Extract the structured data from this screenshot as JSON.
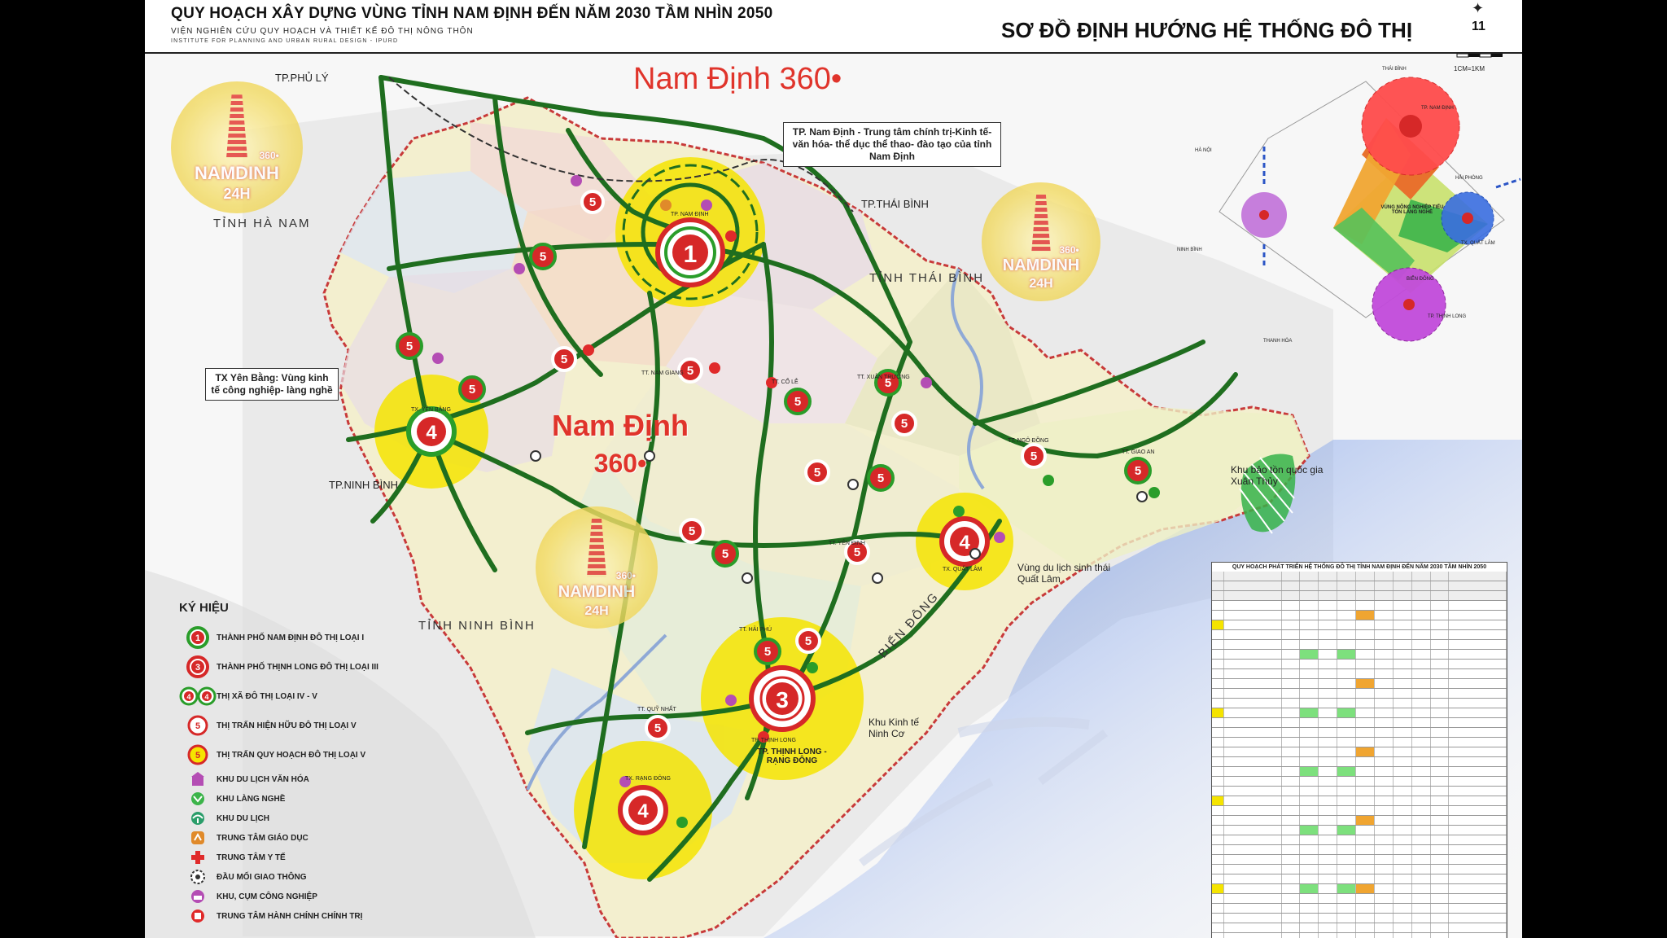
{
  "header": {
    "title": "QUY HOẠCH XÂY DỰNG VÙNG TỈNH NAM ĐỊNH ĐẾN NĂM 2030 TẦM NHÌN 2050",
    "subtitle_vn": "VIỆN NGHIÊN CỨU QUY HOẠCH VÀ THIẾT KẾ ĐÔ THỊ NÔNG THÔN",
    "subtitle_en": "INSTITUTE FOR PLANNING AND URBAN RURAL DESIGN - IPURD",
    "map_title": "SƠ ĐỒ ĐỊNH HƯỚNG HỆ THỐNG ĐÔ THỊ",
    "page_number": "11",
    "scale_label": "1CM=1KM"
  },
  "branding": {
    "watermark_top": "Nam Định 360•",
    "watermark_center_1": "Nam Định",
    "watermark_center_2": "360•",
    "logo_text": "NAMDINH",
    "logo_sub": "24H",
    "logo_badge": "360•"
  },
  "regions": {
    "ha_nam": "TỈNH HÀ NAM",
    "thai_binh": "TỈNH THÁI BÌNH",
    "ninh_binh": "TỈNH NINH BÌNH",
    "bien_dong": "BIỂN ĐÔNG"
  },
  "cities": {
    "phu_ly": "TP.PHỦ LÝ",
    "thai_binh": "TP.THÁI BÌNH",
    "ninh_binh": "TP.NINH BÌNH"
  },
  "callouts": {
    "nam_dinh": "TP. Nam Định - Trung tâm chính trị-Kinh tế-văn hóa- thể dục thể thao- đào tạo của tỉnh Nam Định",
    "yen_bang": "TX Yên Bằng: Vùng kinh tế công nghiệp- làng nghề",
    "xuan_thuy": "Khu bảo tồn quốc gia Xuân Thủy",
    "quat_lam": "Vùng du lịch sinh thái Quất Lâm",
    "ninh_co": "Khu Kinh tế Ninh Cơ",
    "thinh_long": "TP. THỊNH LONG - RẠNG ĐÔNG"
  },
  "towns": [
    {
      "id": "1",
      "name": "TP. NAM ĐỊNH"
    },
    {
      "id": "3",
      "name": "TP. THỊNH LONG"
    },
    {
      "id": "4a",
      "name": "TX. YÊN BẰNG"
    },
    {
      "id": "4b",
      "name": "TX. QUẤT LÂM"
    },
    {
      "id": "4c",
      "name": "TX. RẠNG ĐÔNG"
    },
    {
      "id": "5",
      "name": "TT. NAM GIANG"
    },
    {
      "id": "5",
      "name": "TT. CỔ LỄ"
    },
    {
      "id": "5",
      "name": "TT. XUÂN TRƯỜNG"
    },
    {
      "id": "5",
      "name": "TT. NGÔ ĐỒNG"
    },
    {
      "id": "5",
      "name": "TT. GIAO AN"
    },
    {
      "id": "5",
      "name": "TT. YÊN ĐỊNH"
    },
    {
      "id": "5",
      "name": "TT. HẢI PHÚ"
    },
    {
      "id": "5",
      "name": "TT. QUỸ NHẤT"
    }
  ],
  "legend": {
    "title": "KÝ HIỆU",
    "items": [
      {
        "sym": "1",
        "text": "THÀNH PHỐ NAM ĐỊNH ĐÔ THỊ LOẠI I"
      },
      {
        "sym": "3",
        "text": "THÀNH PHỐ THỊNH LONG ĐÔ THỊ LOẠI III"
      },
      {
        "sym": "4",
        "text": "THỊ XÃ ĐÔ THỊ LOẠI IV - V"
      },
      {
        "sym": "5",
        "text": "THỊ TRẤN HIỆN HỮU ĐÔ THỊ LOẠI V"
      },
      {
        "sym": "5",
        "text": "THỊ TRẤN QUY HOẠCH ĐÔ THỊ LOẠI V"
      },
      {
        "sym": "travel",
        "text": "KHU DU LỊCH VĂN HÓA"
      },
      {
        "sym": "village",
        "text": "KHU LÀNG NGHỀ"
      },
      {
        "sym": "tourism",
        "text": "KHU DU LỊCH"
      },
      {
        "sym": "edu",
        "text": "TRUNG TÂM GIÁO DỤC"
      },
      {
        "sym": "med",
        "text": "TRUNG TÂM Y TẾ"
      },
      {
        "sym": "transport",
        "text": "ĐẦU MỐI GIAO THÔNG"
      },
      {
        "sym": "industry",
        "text": "KHU, CỤM CÔNG NGHIỆP"
      },
      {
        "sym": "admin",
        "text": "TRUNG TÂM HÀNH CHÍNH CHÍNH TRỊ"
      }
    ]
  },
  "inset": {
    "labels": [
      "THÁI BÌNH",
      "HÀ NỘI",
      "HẢI PHÒNG",
      "NINH BÌNH",
      "THANH HÓA",
      "BIỂN ĐÔNG",
      "TX. QUẤT LÂM",
      "TP. THỊNH LONG",
      "TP. NAM ĐỊNH"
    ],
    "center_label": "VÙNG NÔNG NGHIỆP TIỂU TỐN LÀNG NGHỀ"
  },
  "table": {
    "title": "QUY HOẠCH PHÁT TRIỂN HỆ THỐNG ĐÔ THỊ TỈNH NAM ĐỊNH ĐẾN NĂM 2030 TẦM NHÌN 2050"
  },
  "colors": {
    "road": "#1f7a1f",
    "town_ring": "#d62828",
    "zone": "#f5e400",
    "sea": "#2f6fe0"
  }
}
